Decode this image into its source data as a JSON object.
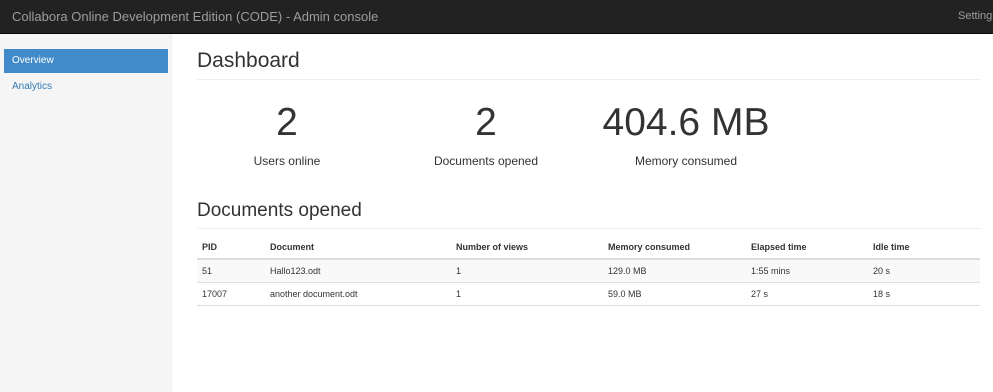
{
  "header": {
    "title": "Collabora Online Development Edition (CODE) - Admin console",
    "settings_label": "Settings"
  },
  "sidebar": {
    "items": [
      {
        "label": "Overview",
        "active": true
      },
      {
        "label": "Analytics",
        "active": false
      }
    ]
  },
  "dashboard": {
    "title": "Dashboard",
    "stats": [
      {
        "value": "2",
        "label": "Users online"
      },
      {
        "value": "2",
        "label": "Documents opened"
      },
      {
        "value": "404.6 MB",
        "label": "Memory consumed"
      }
    ]
  },
  "documents": {
    "title": "Documents opened",
    "columns": [
      "PID",
      "Document",
      "Number of views",
      "Memory consumed",
      "Elapsed time",
      "Idle time"
    ],
    "rows": [
      [
        "51",
        "Hallo123.odt",
        "1",
        "129.0 MB",
        "1:55 mins",
        "20 s"
      ],
      [
        "17007",
        "another document.odt",
        "1",
        "59.0 MB",
        "27 s",
        "18 s"
      ]
    ]
  },
  "colors": {
    "topbar": "#222222",
    "topbar_text": "#9d9d9d",
    "sidebar_bg": "#f5f5f5",
    "active_nav": "#428bca",
    "link": "#337ab7"
  }
}
